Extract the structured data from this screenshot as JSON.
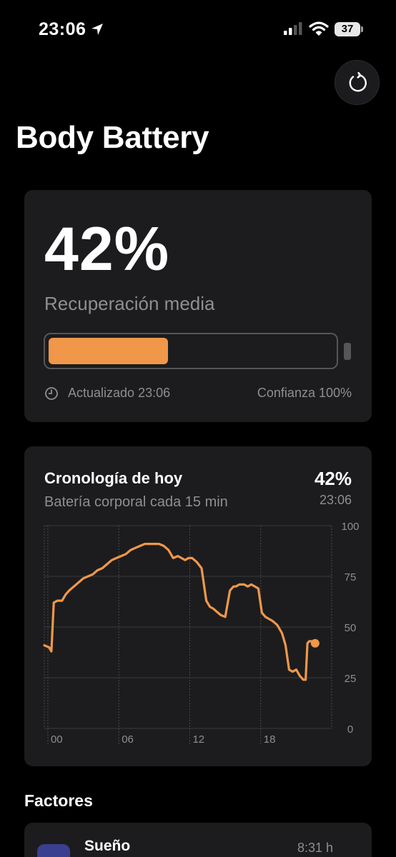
{
  "status_bar": {
    "time": "23:06",
    "battery_level": "37",
    "icons": [
      "location-arrow-icon",
      "cellular-signal-icon",
      "wifi-icon",
      "battery-icon"
    ]
  },
  "header": {
    "title": "Body Battery",
    "refresh_icon": "refresh-icon"
  },
  "summary": {
    "percent": "42%",
    "status": "Recuperación media",
    "progress_fraction": 0.42,
    "updated": "Actualizado 23:06",
    "confidence": "Confianza 100%",
    "accent_color": "#f0974a"
  },
  "timeline": {
    "title": "Cronología de hoy",
    "subtitle": "Batería corporal cada 15 min",
    "current_value": "42%",
    "current_time": "23:06"
  },
  "chart_data": {
    "type": "line",
    "title": "Cronología de hoy",
    "subtitle": "Batería corporal cada 15 min",
    "x_tick_labels": [
      "00",
      "06",
      "12",
      "18"
    ],
    "x_ticks": [
      0,
      6,
      12,
      18
    ],
    "y_tick_labels": [
      "100",
      "75",
      "50",
      "25",
      "0"
    ],
    "xlim": [
      -0.3,
      24
    ],
    "ylim": [
      0,
      100
    ],
    "grid": true,
    "color": "#f0974a",
    "series": [
      {
        "x": [
          -0.3,
          0.1,
          0.3,
          0.5,
          0.8,
          1.2,
          1.5,
          1.8,
          2.2,
          2.6,
          3.0,
          3.4,
          3.8,
          4.2,
          4.6,
          5.0,
          5.4,
          5.8,
          6.2,
          6.6,
          7.0,
          7.4,
          7.8,
          8.2,
          8.6,
          9.0,
          9.4,
          9.8,
          10.2,
          10.6,
          11.0,
          11.3,
          11.6,
          11.9,
          12.2,
          12.6,
          13.0,
          13.4,
          13.7,
          14.0,
          14.2,
          14.6,
          15.0,
          15.4,
          15.7,
          15.9,
          16.2,
          16.6,
          16.9,
          17.2,
          17.5,
          17.8,
          18.1,
          18.4,
          18.7,
          19.0,
          19.4,
          19.8,
          20.1,
          20.4,
          20.7,
          21.0,
          21.3,
          21.6,
          21.8,
          21.95,
          22.1,
          22.3,
          22.6
        ],
        "y": [
          41,
          40,
          38,
          62,
          63,
          63,
          66,
          68,
          70,
          72,
          74,
          75,
          76,
          78,
          79,
          81,
          83,
          84,
          85,
          86,
          88,
          89,
          90,
          91,
          91,
          91,
          91,
          90,
          88,
          84,
          85,
          84,
          83,
          84,
          84,
          82,
          79,
          63,
          60,
          59,
          58,
          56,
          55,
          68,
          70,
          70,
          71,
          71,
          70,
          71,
          70,
          69,
          57,
          55,
          54,
          53,
          51,
          47,
          41,
          29,
          28,
          29,
          26,
          24,
          24,
          42,
          43,
          43,
          42
        ]
      }
    ],
    "end_marker": {
      "x": 22.6,
      "y": 42
    }
  },
  "factors": {
    "heading": "Factores",
    "items": [
      {
        "name": "Sueño",
        "value": "8:31 h",
        "icon": "sleep-icon"
      }
    ]
  }
}
